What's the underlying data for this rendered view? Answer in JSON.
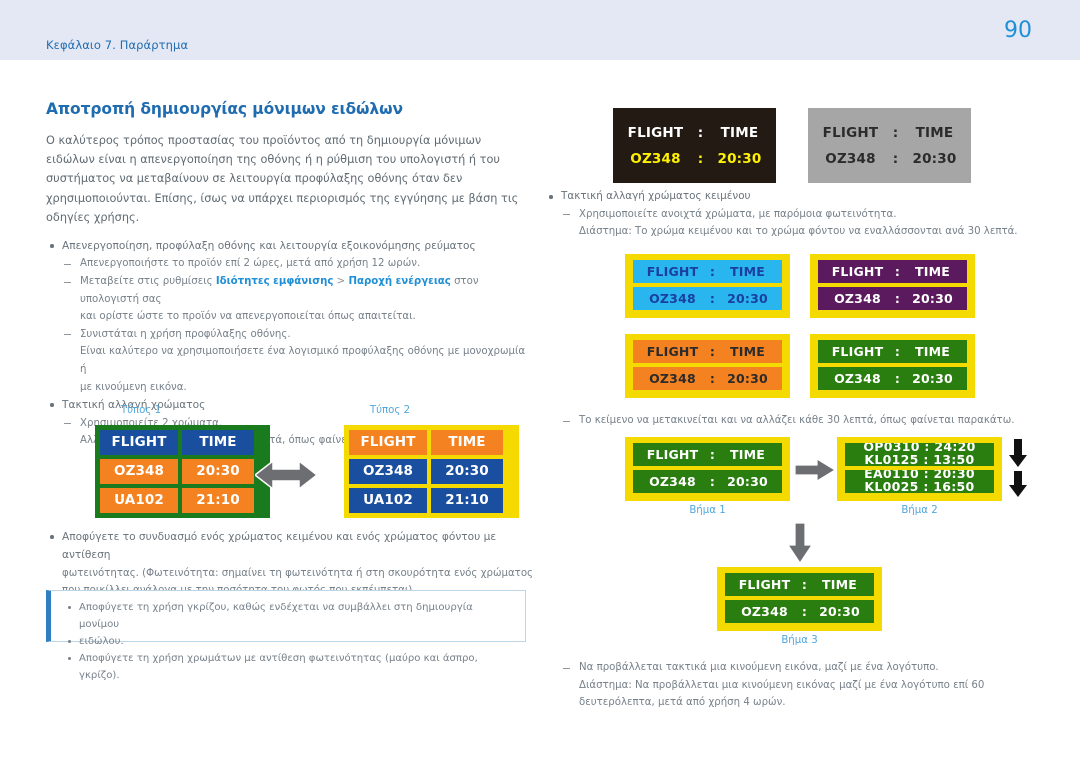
{
  "header": {
    "chapter": "Κεφάλαιο 7. Παράρτημα",
    "page_number": "90",
    "bg_color": "#e4e8f5",
    "link_color": "#1f6cb0"
  },
  "left": {
    "title": "Αποτροπή δημιουργίας μόνιμων ειδώλων",
    "intro": "Ο καλύτερος τρόπος προστασίας του προϊόντος από τη δημιουργία μόνιμων ειδώλων είναι η απενεργοποίηση της οθόνης ή η ρύθμιση του υπολογιστή ή του συστήματος να μεταβαίνουν σε λειτουργία προφύλαξης οθόνης όταν δεν χρησιμοποιούνται. Επίσης, ίσως να υπάρχει περιορισμός της εγγύησης με βάση τις οδηγίες χρήσης.",
    "bullet1": "Απενεργοποίηση, προφύλαξη οθόνης και λειτουργία εξοικονόμησης ρεύματος",
    "dash1": "Απενεργοποιήστε το προϊόν επί 2 ώρες, μετά από χρήση 12 ωρών.",
    "dash2_pre": "Μεταβείτε στις ρυθμίσεις ",
    "dash2_link1": "Ιδιότητες εμφάνισης",
    "dash2_sep": " > ",
    "dash2_link2": "Παροχή ενέργειας",
    "dash2_post": " στον υπολογιστή σας",
    "dash2_line2": "και ορίστε ώστε το προϊόν να απενεργοποιείται όπως απαιτείται.",
    "dash3": "Συνιστάται η χρήση προφύλαξης οθόνης.",
    "dash3_line2": "Είναι καλύτερο να χρησιμοποιήσετε ένα λογισμικό προφύλαξης οθόνης με μονοχρωμία ή",
    "dash3_line3": "με κινούμενη εικόνα.",
    "bullet2": "Τακτική αλλαγή χρώματος",
    "dash4": "Χρησιμοποιείτε 2 χρώματα.",
    "dash4_line2": "Αλλάζετε τα 2 χρώματα κάθε 30 λεπτά, όπως φαίνεται παραπάνω.",
    "bullet3_line1": "Αποφύγετε το συνδυασμό ενός χρώματος κειμένου και ενός χρώματος φόντου με αντίθεση",
    "bullet3_line2": "φωτεινότητας. (Φωτεινότητα: σημαίνει τη φωτεινότητα ή στη σκουρότητα ενός χρώματος",
    "bullet3_line3": "που ποικίλλει ανάλογα με την ποσότητα του φωτός που εκπέμπεται)."
  },
  "callout": {
    "item1_line1": "Αποφύγετε τη χρήση γκρίζου, καθώς ενδέχεται να συμβάλλει στη δημιουργία μονίμου",
    "item1_line2": "ειδώλου.",
    "item2": "Αποφύγετε τη χρήση χρωμάτων με αντίθεση φωτεινότητας (μαύρο και άσπρο, γκρίζο).",
    "border_color": "#bcd6e8",
    "accent_color": "#2f7fc1"
  },
  "type_tables": {
    "type1_label": "Τύπος 1",
    "type2_label": "Τύπος 2",
    "header_flight": "FLIGHT",
    "header_time": "TIME",
    "rows": [
      {
        "flight": "OZ348",
        "time": "20:30"
      },
      {
        "flight": "UA102",
        "time": "21:10"
      }
    ],
    "type1": {
      "border_color": "#1a7a1e",
      "header_bg": "#1a4fa0",
      "header_text": "#ffffff",
      "row_bg": "#f58220",
      "row_text": "#ffffff"
    },
    "type2": {
      "border_color": "#f5da00",
      "header_bg": "#f58220",
      "header_text": "#ffffff",
      "row_bg": "#1a4fa0",
      "row_text": "#ffffff"
    },
    "arrow_icon": "double-arrow-horizontal",
    "arrow_color": "#6d6e71"
  },
  "right": {
    "top_panels": [
      {
        "name": "dark",
        "bg": "#231a13",
        "header_text_color": "#ffffff",
        "row_text_color": "#fff200"
      },
      {
        "name": "gray",
        "bg": "#a6a6a6",
        "header_text_color": "#2b2b2b",
        "row_text_color": "#2b2b2b"
      }
    ],
    "panel_header_flight": "FLIGHT",
    "panel_colon": ":",
    "panel_header_time": "TIME",
    "panel_row_flight": "OZ348",
    "panel_row_time": "20:30",
    "bullet1": "Τακτική αλλαγή χρώματος κειμένου",
    "dash1": "Χρησιμοποιείτε ανοιχτά χρώματα, με παρόμοια φωτεινότητα.",
    "dash1_line2": "Διάστημα: Το χρώμα κειμένου και το χρώμα φόντου να εναλλάσσονται ανά 30 λεπτά.",
    "grid_panels": [
      {
        "name": "cyan",
        "bg": "#29b6ef",
        "text": "#1a3fa0"
      },
      {
        "name": "purple",
        "bg": "#5b1a5e",
        "text": "#ffffff"
      },
      {
        "name": "orange",
        "bg": "#f58220",
        "text": "#2b2b2b"
      },
      {
        "name": "green",
        "bg": "#2a7d0f",
        "text": "#ffffff"
      }
    ],
    "frame_color": "#f5da00",
    "dash2": "Το κείμενο να μετακινείται και να αλλάζει κάθε 30 λεπτά, όπως φαίνεται παρακάτω.",
    "steps": {
      "step1_label": "Βήμα 1",
      "step2_label": "Βήμα 2",
      "step3_label": "Βήμα 3",
      "step2_lines": [
        "OP0310 : 24:20",
        "KL0125 : 13:50",
        "EA0110 : 20:30",
        "KL0025 : 16:50"
      ],
      "arrow_right_icon": "arrow-right",
      "arrow_down_icon": "arrow-down",
      "arrow_color": "#6d6e71"
    },
    "dash3": "Να προβάλλεται τακτικά μια κινούμενη εικόνα, μαζί με ένα λογότυπο.",
    "dash3_line2": "Διάστημα: Να προβάλλεται μια κινούμενη εικόνας μαζί με ένα λογότυπο επί 60",
    "dash3_line3": "δευτερόλεπτα, μετά από χρήση 4 ωρών."
  }
}
